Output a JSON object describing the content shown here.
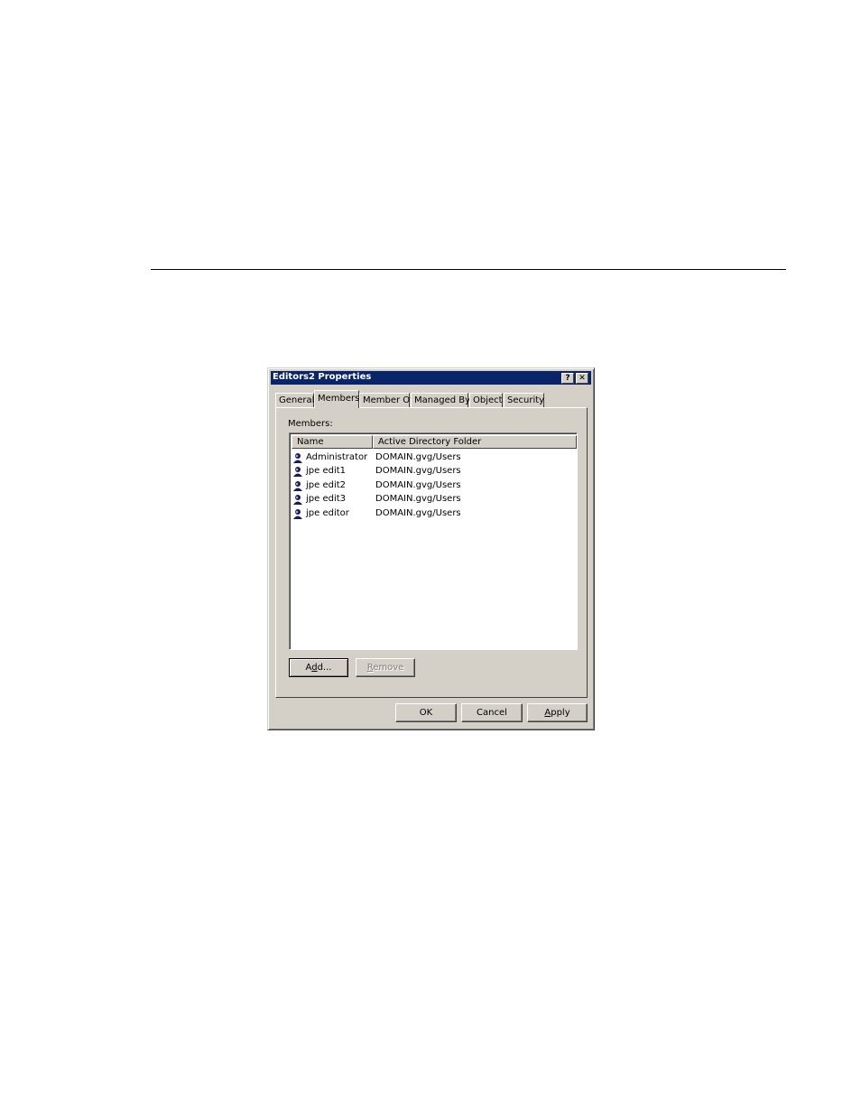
{
  "dialog": {
    "title": "Editors2 Properties",
    "help_glyph": "?",
    "close_glyph": "✕"
  },
  "tabs": [
    {
      "label": "General",
      "active": false
    },
    {
      "label": "Members",
      "active": true
    },
    {
      "label": "Member Of",
      "active": false
    },
    {
      "label": "Managed By",
      "active": false
    },
    {
      "label": "Object",
      "active": false
    },
    {
      "label": "Security",
      "active": false
    }
  ],
  "members": {
    "label": "Members:",
    "columns": [
      "Name",
      "Active Directory Folder"
    ],
    "rows": [
      {
        "name": "Administrator",
        "folder": "DOMAIN.gvg/Users",
        "icon": "user-icon"
      },
      {
        "name": "jpe edit1",
        "folder": "DOMAIN.gvg/Users",
        "icon": "user-icon"
      },
      {
        "name": "jpe edit2",
        "folder": "DOMAIN.gvg/Users",
        "icon": "user-icon"
      },
      {
        "name": "jpe edit3",
        "folder": "DOMAIN.gvg/Users",
        "icon": "user-icon"
      },
      {
        "name": "jpe editor",
        "folder": "DOMAIN.gvg/Users",
        "icon": "user-icon"
      }
    ]
  },
  "buttons": {
    "add": {
      "pre": "A",
      "ul": "d",
      "post": "d..."
    },
    "remove": {
      "pre": "",
      "ul": "R",
      "post": "emove"
    },
    "ok": "OK",
    "cancel": "Cancel",
    "apply": {
      "pre": "",
      "ul": "A",
      "post": "pply"
    }
  },
  "colors": {
    "titlebar": "#0a246a",
    "face": "#d4d0c8"
  }
}
